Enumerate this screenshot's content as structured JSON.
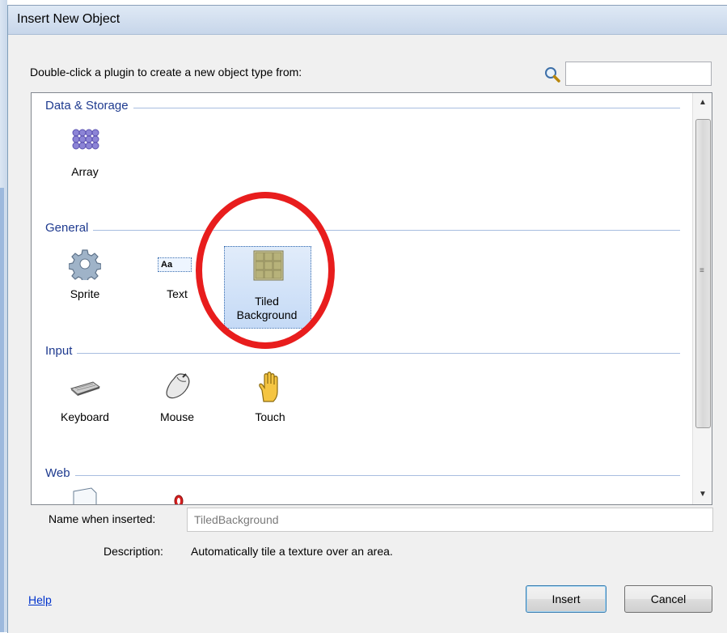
{
  "dialog": {
    "title": "Insert New Object",
    "prompt": "Double-click a plugin to create a new object type from:",
    "search_placeholder": ""
  },
  "categories": [
    {
      "label": "Data & Storage",
      "items": [
        {
          "label": "Array",
          "icon": "array-icon"
        }
      ]
    },
    {
      "label": "General",
      "items": [
        {
          "label": "Sprite",
          "icon": "sprite-gear-icon"
        },
        {
          "label": "Text",
          "icon": "text-icon"
        },
        {
          "label": "Tiled Background",
          "icon": "tiled-background-icon",
          "selected": true
        }
      ]
    },
    {
      "label": "Input",
      "items": [
        {
          "label": "Keyboard",
          "icon": "keyboard-icon"
        },
        {
          "label": "Mouse",
          "icon": "mouse-icon"
        },
        {
          "label": "Touch",
          "icon": "touch-hand-icon"
        }
      ]
    },
    {
      "label": "Web",
      "items": [
        {
          "label": "",
          "icon": "web-page-icon"
        },
        {
          "label": "",
          "icon": "browser-icon"
        }
      ]
    }
  ],
  "text_icon_glyph": "Aa",
  "form": {
    "name_label": "Name when inserted:",
    "name_value": "TiledBackground",
    "description_label": "Description:",
    "description_value": "Automatically tile a texture over an area."
  },
  "footer": {
    "help": "Help",
    "insert": "Insert",
    "cancel": "Cancel"
  },
  "colors": {
    "annotation_circle": "#e81d1d",
    "category_text": "#1e3a8f",
    "link": "#0033cc"
  }
}
